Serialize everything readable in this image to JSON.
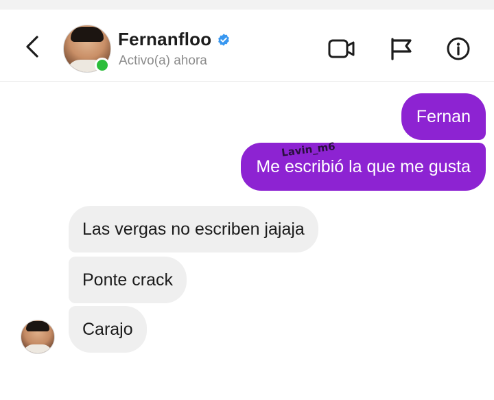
{
  "header": {
    "contact_name": "Fernanfloo",
    "status": "Activo(a) ahora",
    "verified_icon": "verified-badge-icon",
    "icons": {
      "back": "chevron-left-icon",
      "video": "video-call-icon",
      "flag": "flag-icon",
      "info": "info-icon"
    }
  },
  "messages": {
    "sent": [
      {
        "text": "Fernan"
      },
      {
        "text": "Me escribió la que me gusta"
      }
    ],
    "received": [
      {
        "text": "Las vergas no escriben jajaja"
      },
      {
        "text": "Ponte crack"
      },
      {
        "text": "Carajo"
      }
    ]
  },
  "watermark": "Lavin_m6",
  "colors": {
    "sent_bubble": "#8d23d2",
    "received_bubble": "#efefef",
    "online": "#2bbd3a",
    "verified": "#3897f0"
  }
}
